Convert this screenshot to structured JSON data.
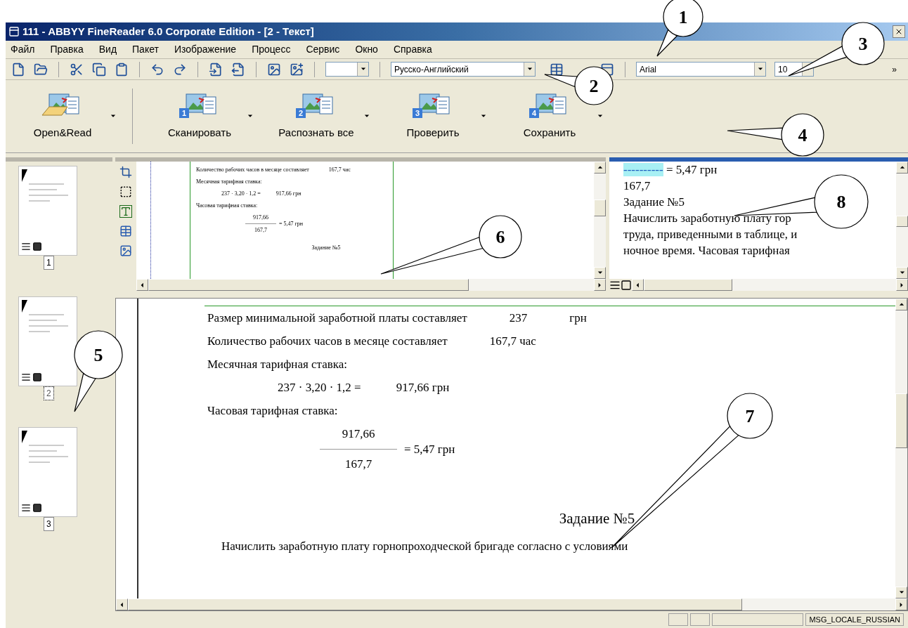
{
  "window": {
    "title": "111 - ABBYY FineReader 6.0 Corporate Edition - [2 - Текст]"
  },
  "menu": [
    "Файл",
    "Правка",
    "Вид",
    "Пакет",
    "Изображение",
    "Процесс",
    "Сервис",
    "Окно",
    "Справка"
  ],
  "toolbar": {
    "language": "Русско-Английский",
    "font": "Arial",
    "size": "10",
    "overflow": "»"
  },
  "big_toolbar": [
    {
      "label": "Open&Read"
    },
    {
      "label": "Сканировать",
      "step": "1"
    },
    {
      "label": "Распознать все",
      "step": "2"
    },
    {
      "label": "Проверить",
      "step": "3"
    },
    {
      "label": "Сохранить",
      "step": "4"
    }
  ],
  "pages": [
    {
      "number": "1",
      "selected": false
    },
    {
      "number": "2",
      "selected": true
    },
    {
      "number": "3",
      "selected": false
    }
  ],
  "image_pane": {
    "lines": [
      {
        "kind": "row",
        "parts": [
          "Количество рабочих часов в месяце составляет",
          "167,7 час"
        ]
      },
      {
        "kind": "row",
        "parts": [
          "Месячная тарифная ставка:"
        ]
      },
      {
        "kind": "formula",
        "parts": [
          "237 · 3,20 · 1,2 =",
          "917,66 грн"
        ]
      },
      {
        "kind": "row",
        "parts": [
          "Часовая тарифная ставка:"
        ]
      },
      {
        "kind": "fraction",
        "numerator": "917,66",
        "result": "= 5,47 грн",
        "denominator": "167,7"
      },
      {
        "kind": "heading",
        "parts": [
          "Задание №5"
        ]
      }
    ]
  },
  "text_pane": {
    "lines": [
      {
        "highlight": "----------",
        "text": " = 5,47   грн"
      },
      {
        "text": "167,7"
      },
      {
        "text": "Задание №5"
      },
      {
        "text": "Начислить заработную плату гор"
      },
      {
        "text": "труда, приведенными в таблице, и"
      },
      {
        "text": "ночное время. Часовая тарифная"
      }
    ]
  },
  "document": {
    "lines": [
      {
        "kind": "row",
        "parts": [
          "Размер минимальной заработной платы составляет",
          "237",
          "грн"
        ]
      },
      {
        "kind": "row",
        "parts": [
          "Количество рабочих часов в месяце составляет",
          "167,7 час"
        ]
      },
      {
        "kind": "row",
        "parts": [
          "Месячная тарифная ставка:"
        ]
      },
      {
        "kind": "formula",
        "parts": [
          "237 · 3,20 · 1,2 =",
          "917,66 грн"
        ]
      },
      {
        "kind": "row",
        "parts": [
          "Часовая тарифная ставка:"
        ]
      },
      {
        "kind": "fraction",
        "numerator": "917,66",
        "result": "= 5,47 грн",
        "denominator": "167,7"
      },
      {
        "kind": "heading",
        "parts": [
          "Задание №5"
        ]
      },
      {
        "kind": "para",
        "parts": [
          "Начислить заработную плату горнопроходческой бригаде согласно с условиями"
        ]
      }
    ]
  },
  "status_bar": {
    "locale": "MSG_LOCALE_RUSSIAN"
  },
  "callouts": [
    "1",
    "2",
    "3",
    "4",
    "5",
    "6",
    "7",
    "8"
  ]
}
